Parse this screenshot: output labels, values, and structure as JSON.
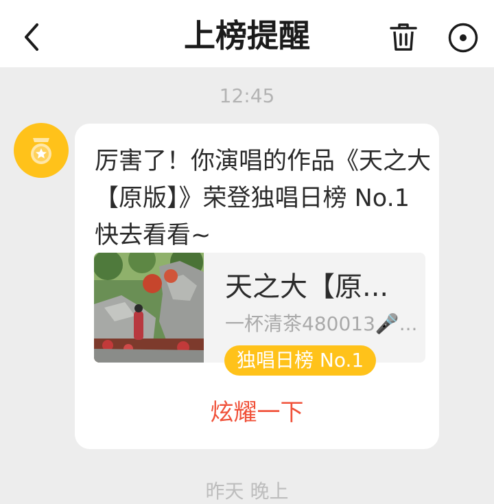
{
  "header": {
    "title": "上榜提醒",
    "icons": {
      "back": "chevron-left-icon",
      "delete": "trash-icon",
      "more": "circle-dot-icon"
    }
  },
  "chat": {
    "time": "12:45",
    "avatar_icon": "medal-icon",
    "message": "厉害了！你演唱的作品《天之大【原版】》荣登独唱日榜 No.1快去看看~",
    "card": {
      "song_title": "天之大【原...",
      "singer": "一杯清茶480013🎤...",
      "badge": "独唱日榜 No.1"
    },
    "action": "炫耀一下"
  },
  "next_time": "昨天 晚上"
}
